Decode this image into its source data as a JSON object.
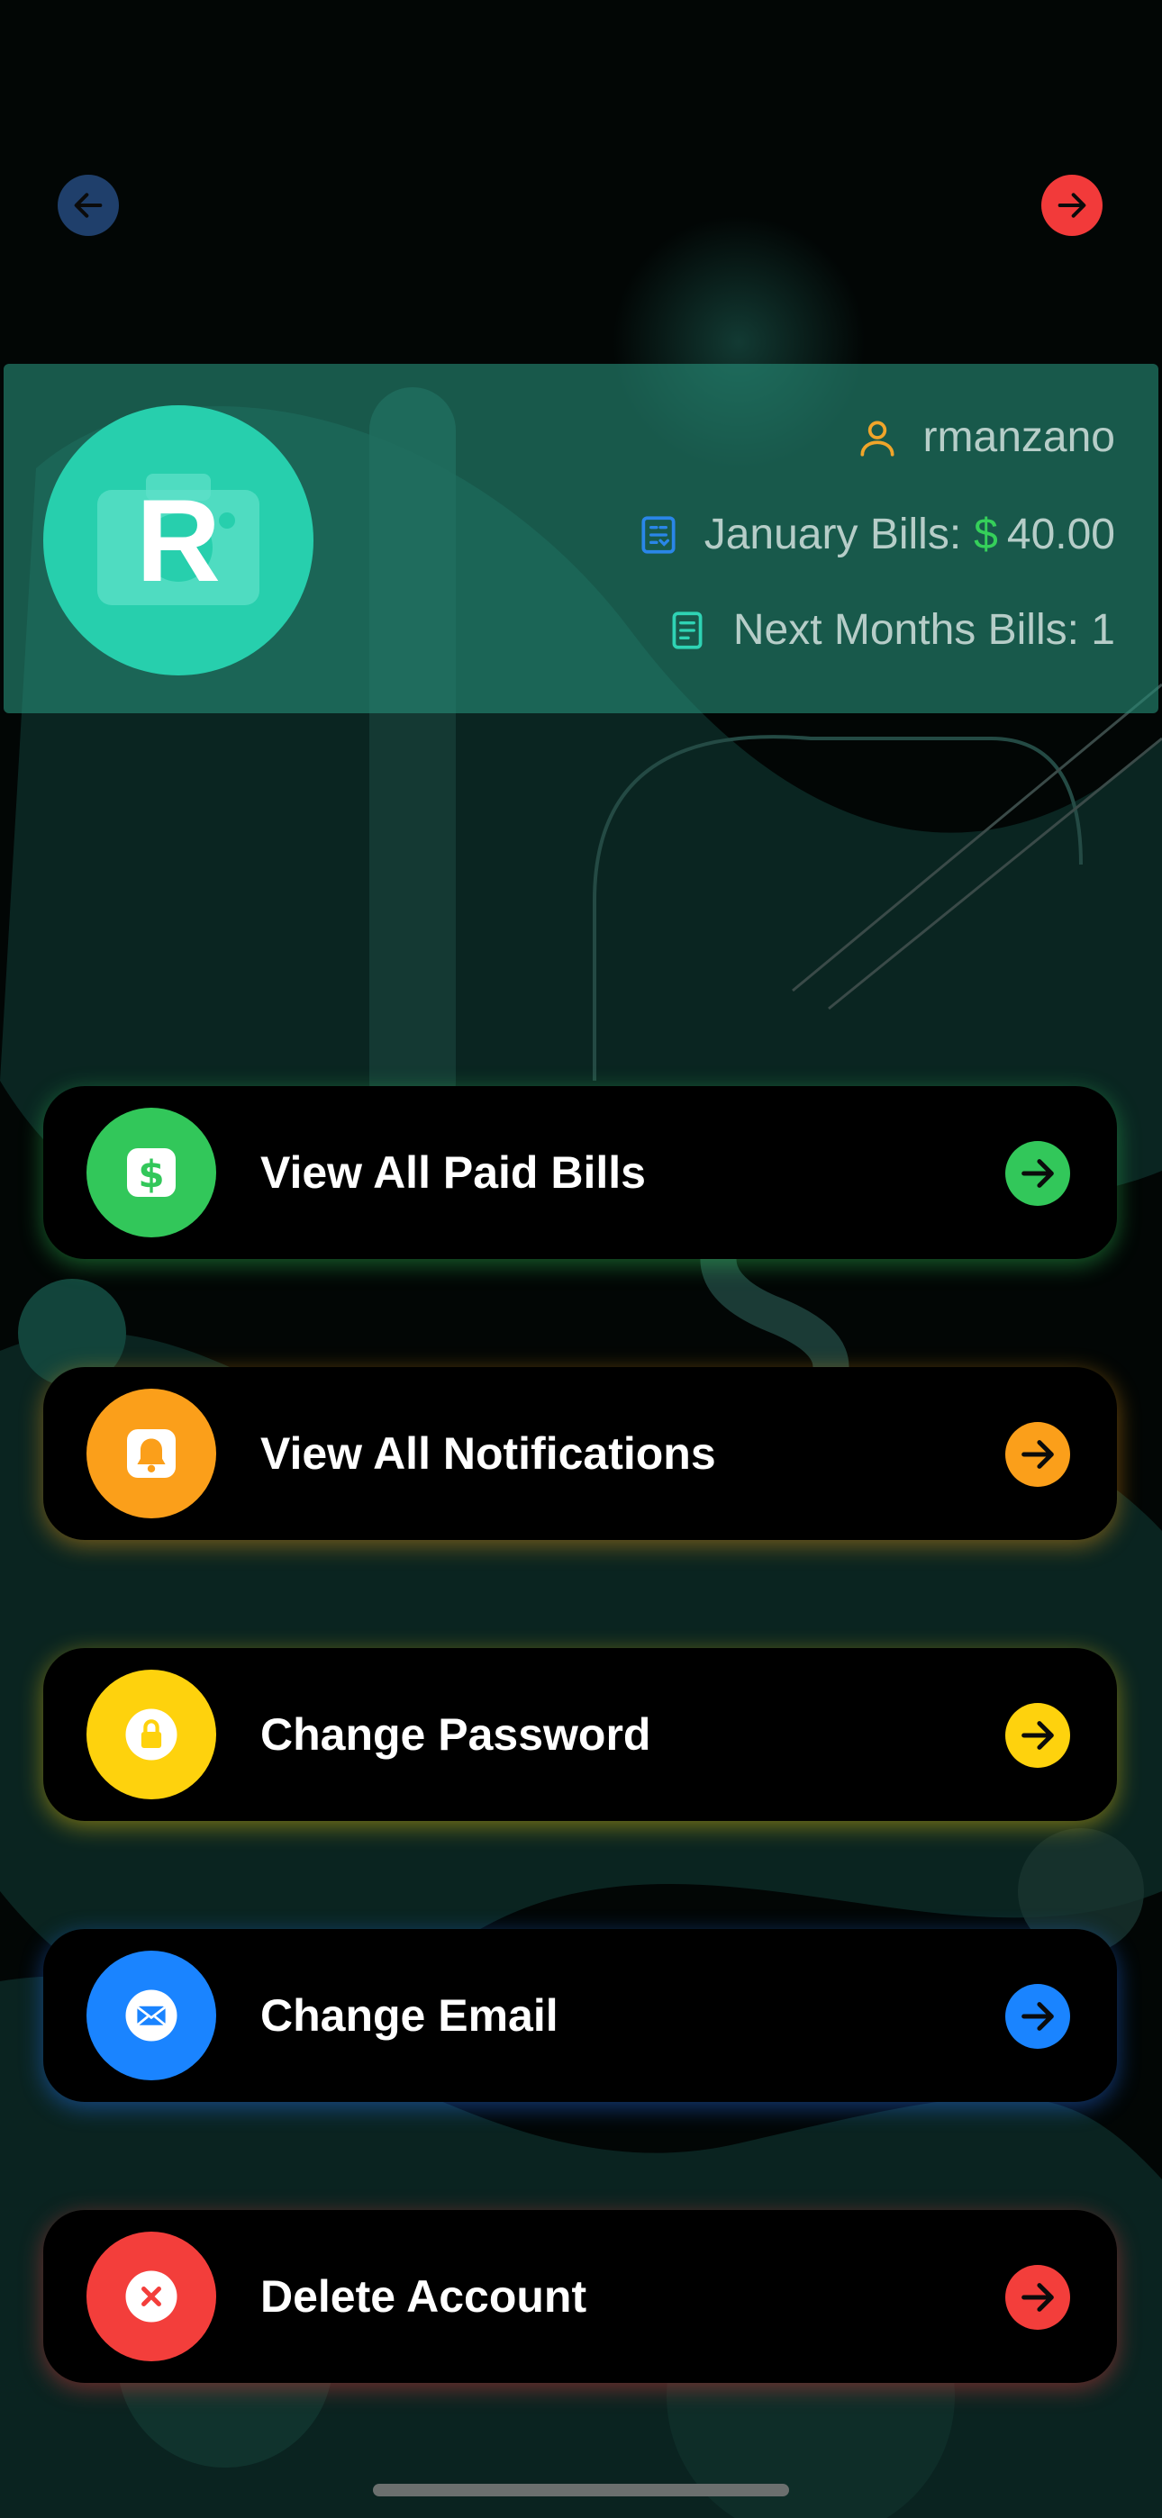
{
  "header": {
    "back_icon": "arrow-left-icon",
    "forward_icon": "arrow-right-icon"
  },
  "profile": {
    "avatar_initial": "R",
    "username": "rmanzano",
    "bills_label": "January Bills:",
    "bills_currency": "$",
    "bills_amount": "40.00",
    "next_months_label": "Next Months Bills: 1"
  },
  "menu": [
    {
      "label": "View All Paid Bills",
      "icon": "dollar-icon",
      "color": "#32c75a"
    },
    {
      "label": "View All Notifications",
      "icon": "bell-icon",
      "color": "#fb9f1a"
    },
    {
      "label": "Change Password",
      "icon": "lock-icon",
      "color": "#fed20d"
    },
    {
      "label": "Change Email",
      "icon": "envelope-icon",
      "color": "#1a84ff"
    },
    {
      "label": "Delete Account",
      "icon": "x-mark-icon",
      "color": "#f33e3b"
    }
  ],
  "colors": {
    "background": "#020605",
    "profile_card": "#268c78",
    "avatar": "#27cfad",
    "user_icon": "#f0a52a",
    "bills_icon": "#2a86e8",
    "next_icon": "#2fd3b4"
  }
}
